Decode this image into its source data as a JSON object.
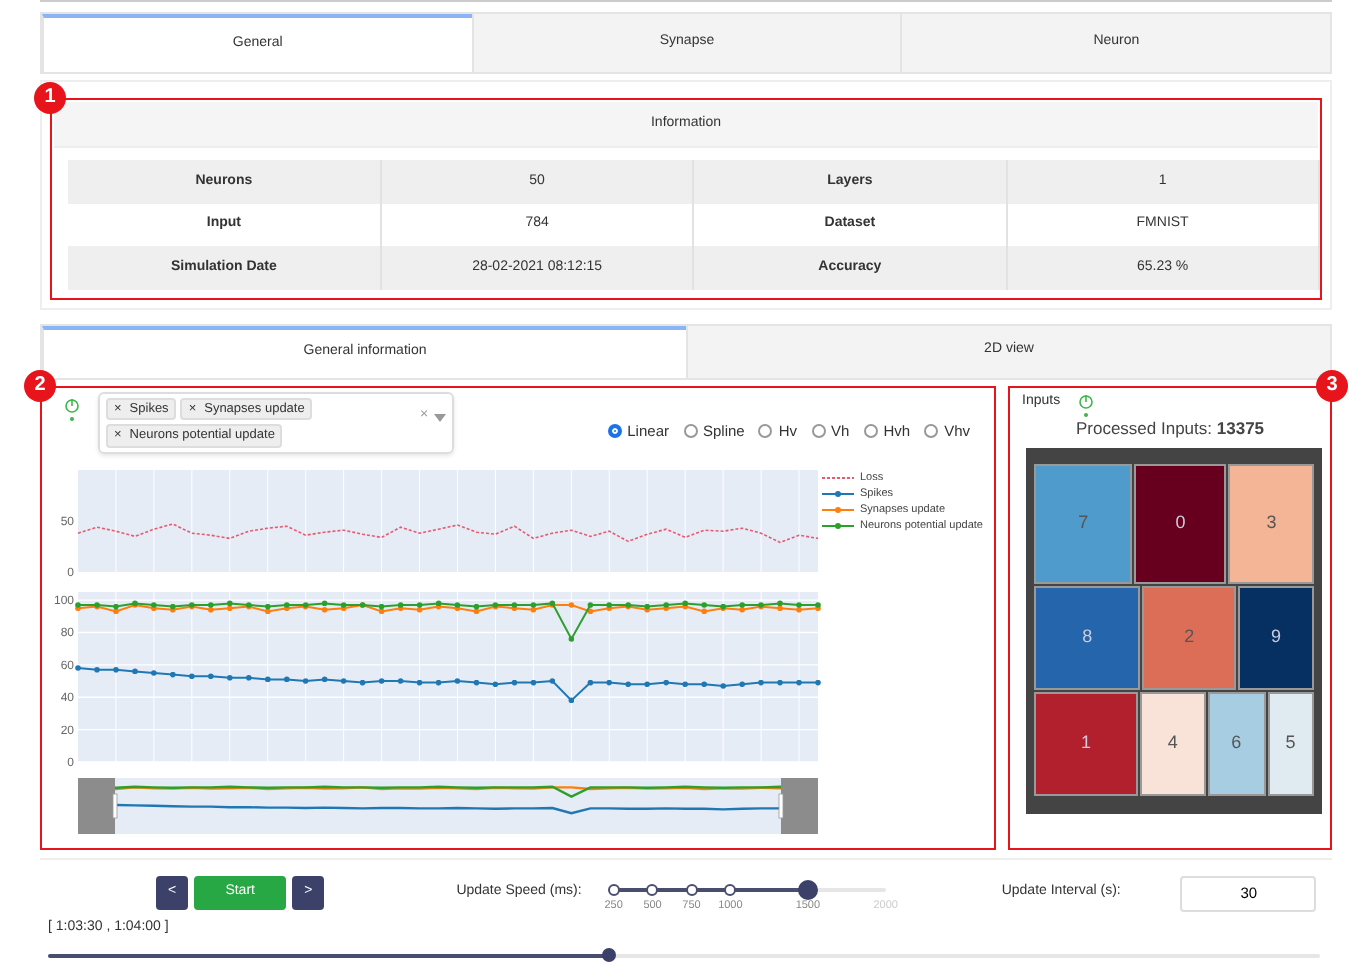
{
  "tabs": [
    {
      "label": "General",
      "selected": true
    },
    {
      "label": "Synapse",
      "selected": false
    },
    {
      "label": "Neuron",
      "selected": false
    }
  ],
  "information": {
    "callout": "1",
    "title": "Information",
    "rows": [
      {
        "cells": [
          "Neurons",
          "50",
          "Layers",
          "1"
        ]
      },
      {
        "cells": [
          "Input",
          "784",
          "Dataset",
          "FMNIST"
        ]
      },
      {
        "cells": [
          "Simulation Date",
          "28-02-2021 08:12:15",
          "Accuracy",
          "65.23 %"
        ]
      }
    ]
  },
  "subtabs": [
    {
      "label": "General information",
      "selected": true
    },
    {
      "label": "2D view",
      "selected": false
    }
  ],
  "graphs": {
    "callout": "2",
    "power_on": true,
    "selector": {
      "tags": [
        {
          "remove": "×",
          "label": "Spikes"
        },
        {
          "remove": "×",
          "label": "Synapses update"
        },
        {
          "remove": "×",
          "label": "Neurons potential update"
        }
      ],
      "clear": "×"
    },
    "line_shapes": [
      {
        "label": "Linear",
        "selected": true
      },
      {
        "label": "Spline",
        "selected": false
      },
      {
        "label": "Hv",
        "selected": false
      },
      {
        "label": "Vh",
        "selected": false
      },
      {
        "label": "Hvh",
        "selected": false
      },
      {
        "label": "Vhv",
        "selected": false
      }
    ],
    "charts": [
      {
        "chart_data": {
          "type": "line",
          "grid": true,
          "ylim": [
            0,
            100
          ],
          "yticks": [
            0,
            50
          ],
          "series": [
            {
              "name": "Loss",
              "color": "#e8596e",
              "line_style": "dashed",
              "values": [
                38,
                44,
                40,
                35,
                42,
                47,
                38,
                36,
                33,
                40,
                43,
                45,
                36,
                39,
                41,
                37,
                34,
                44,
                38,
                42,
                46,
                39,
                37,
                45,
                33,
                38,
                41,
                35,
                40,
                30,
                37,
                42,
                34,
                41,
                40,
                43,
                38,
                29,
                36,
                33
              ]
            }
          ]
        }
      },
      {
        "chart_data": {
          "type": "line",
          "grid": true,
          "ylim": [
            0,
            105
          ],
          "yticks": [
            0,
            20,
            40,
            60,
            80,
            100
          ],
          "series": [
            {
              "name": "Spikes",
              "color": "#1f77b4",
              "line_style": "solid",
              "values": [
                58,
                57,
                57,
                56,
                55,
                54,
                53,
                53,
                52,
                52,
                51,
                51,
                50,
                51,
                50,
                49,
                50,
                50,
                49,
                49,
                50,
                49,
                48,
                49,
                49,
                50,
                38,
                49,
                49,
                48,
                48,
                49,
                48,
                48,
                47,
                48,
                49,
                49,
                49,
                49
              ]
            },
            {
              "name": "Synapses update",
              "color": "#ff7f0e",
              "line_style": "solid",
              "values": [
                95,
                96,
                93,
                97,
                95,
                94,
                96,
                94,
                95,
                96,
                93,
                95,
                96,
                94,
                95,
                97,
                93,
                95,
                94,
                96,
                95,
                93,
                96,
                95,
                94,
                97,
                97,
                93,
                95,
                96,
                94,
                95,
                96,
                93,
                95,
                94,
                96,
                95,
                94,
                95
              ]
            },
            {
              "name": "Neurons potential update",
              "color": "#2ca02c",
              "line_style": "solid",
              "values": [
                97,
                97,
                96,
                98,
                97,
                96,
                97,
                97,
                98,
                97,
                96,
                97,
                97,
                98,
                97,
                97,
                96,
                97,
                97,
                98,
                97,
                96,
                97,
                97,
                97,
                98,
                76,
                97,
                97,
                97,
                96,
                97,
                98,
                97,
                96,
                97,
                97,
                98,
                97,
                97
              ]
            }
          ]
        }
      }
    ]
  },
  "inputs": {
    "callout": "3",
    "title": "Inputs",
    "power_on": true,
    "processed_label": "Processed Inputs:",
    "processed_value": "13375",
    "treemap": [
      [
        {
          "label": "7",
          "color": "#4f9bcb"
        },
        {
          "label": "0",
          "color": "#67001f"
        },
        {
          "label": "3",
          "color": "#f4b596"
        }
      ],
      [
        {
          "label": "8",
          "color": "#2565ab"
        },
        {
          "label": "2",
          "color": "#dc6e57"
        },
        {
          "label": "9",
          "color": "#053061"
        }
      ],
      [
        {
          "label": "1",
          "color": "#b2202e"
        },
        {
          "label": "4",
          "color": "#f9e2d7"
        },
        {
          "label": "6",
          "color": "#a6cde2"
        },
        {
          "label": "5",
          "color": "#dfeaf1"
        }
      ]
    ]
  },
  "controls": {
    "prev": "<",
    "start": "Start",
    "next": ">",
    "speed_label": "Update Speed (ms):",
    "speed_marks": [
      {
        "label": "250"
      },
      {
        "label": "500"
      },
      {
        "label": "750"
      },
      {
        "label": "1000"
      },
      {
        "label": "1500"
      },
      {
        "label": "2000"
      }
    ],
    "speed_slider": {
      "level": 0.714
    },
    "interval_label": "Update Interval (s):",
    "interval_value": "30",
    "time_range": "[ 1:03:30 , 1:04:00 ]",
    "time_slider": {
      "level": 0.44
    }
  }
}
